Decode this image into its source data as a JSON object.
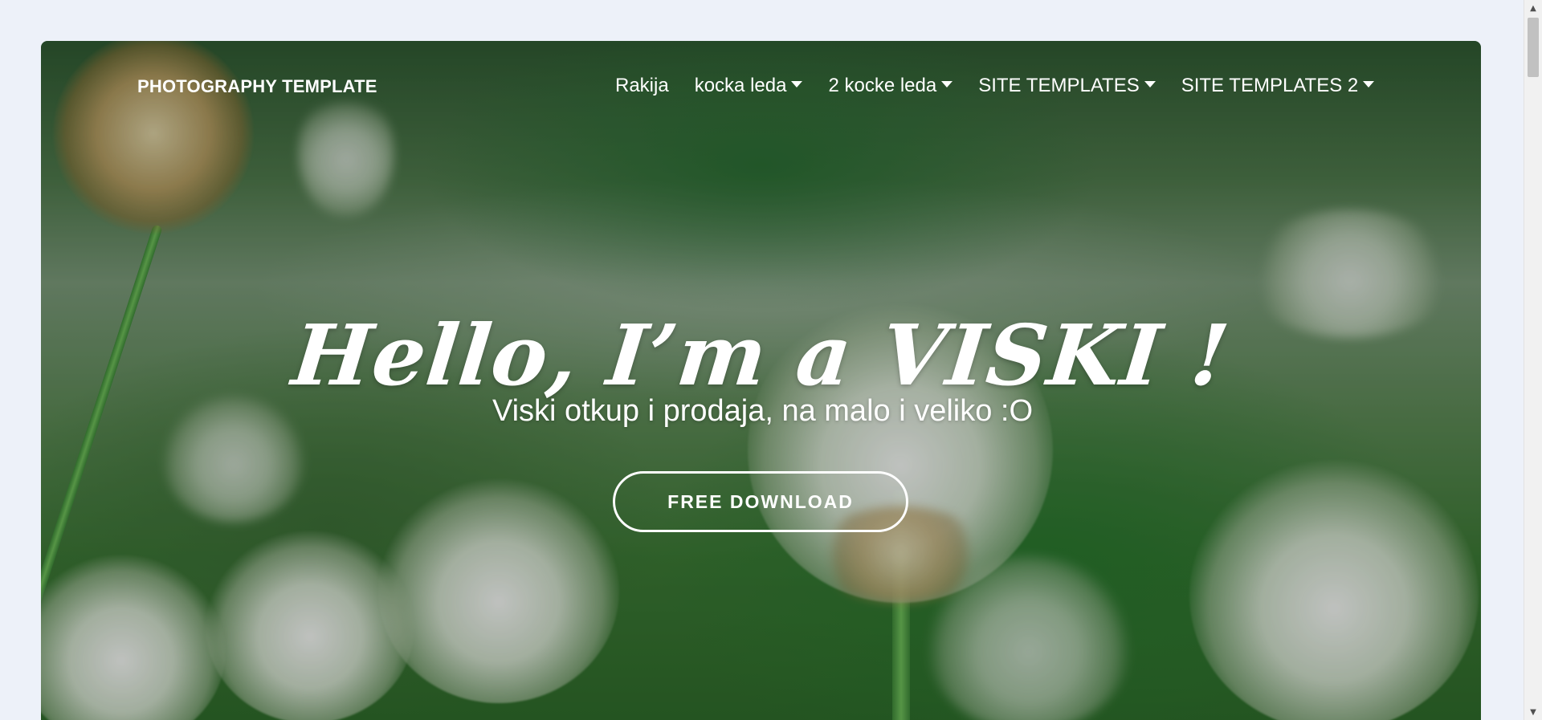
{
  "nav": {
    "brand": "PHOTOGRAPHY TEMPLATE",
    "items": [
      {
        "label": "Rakija",
        "dropdown": false
      },
      {
        "label": "kocka leda",
        "dropdown": true
      },
      {
        "label": "2 kocke leda",
        "dropdown": true
      },
      {
        "label": "SITE TEMPLATES",
        "dropdown": true
      },
      {
        "label": "SITE TEMPLATES 2",
        "dropdown": true
      }
    ]
  },
  "hero": {
    "title": "Hello, I’m a VISKI !",
    "subtitle": "Viski otkup i prodaja, na malo i veliko :O",
    "cta_label": "FREE DOWNLOAD",
    "background_description_icon": "clover-flowers-photo"
  },
  "colors": {
    "page_background": "#edf1f9",
    "text": "#ffffff",
    "accent_green": "#3c7a35"
  }
}
